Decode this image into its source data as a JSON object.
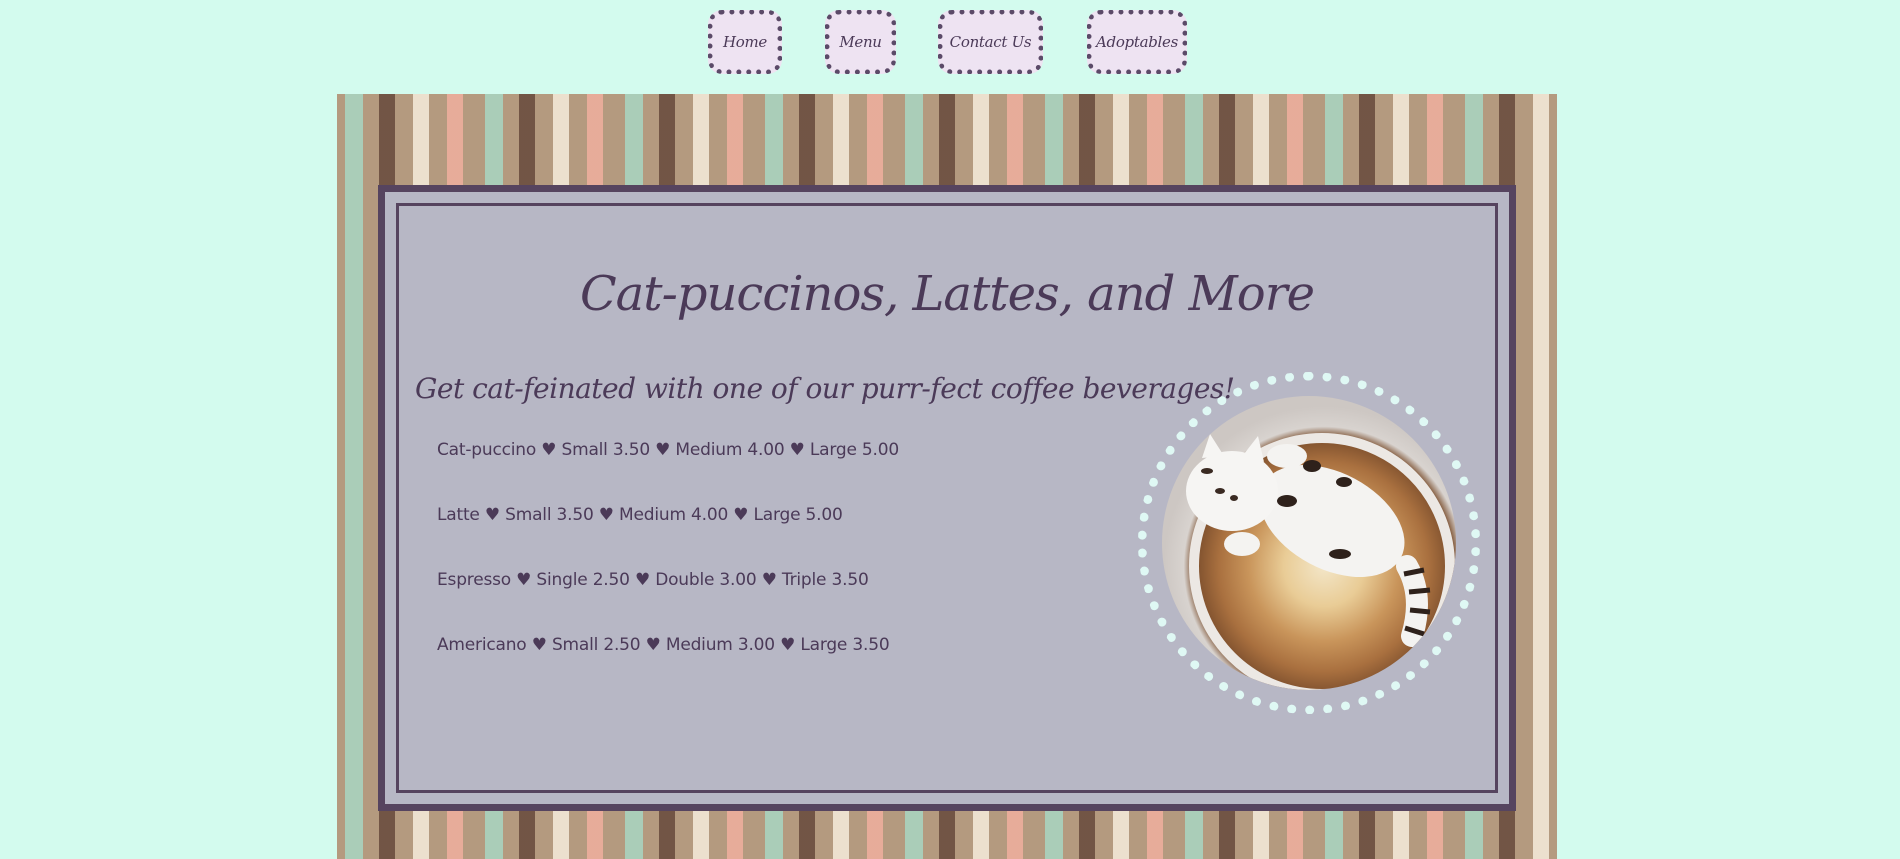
{
  "nav": {
    "items": [
      {
        "label": "Home"
      },
      {
        "label": "Menu"
      },
      {
        "label": "Contact Us"
      },
      {
        "label": "Adoptables"
      }
    ]
  },
  "page": {
    "title": "Cat-puccinos, Lattes, and More",
    "subtitle": "Get cat-feinated with one of our purr-fect coffee beverages!"
  },
  "menu": {
    "items": [
      "Cat-puccino ♥ Small 3.50 ♥ Medium 4.00 ♥ Large 5.00",
      "Latte ♥ Small 3.50 ♥ Medium 4.00 ♥ Large 5.00",
      "Espresso ♥ Single 2.50 ♥ Double 3.00 ♥ Triple 3.50",
      "Americano ♥ Small 2.50 ♥ Medium 3.00 ♥ Large 3.50"
    ]
  },
  "colors": {
    "background": "#d3fbee",
    "panel": "#b7b7c5",
    "accent": "#56445f",
    "nav_button": "#eee3f2"
  },
  "images": {
    "coffee_photo": "cat-latte-art-photo"
  }
}
